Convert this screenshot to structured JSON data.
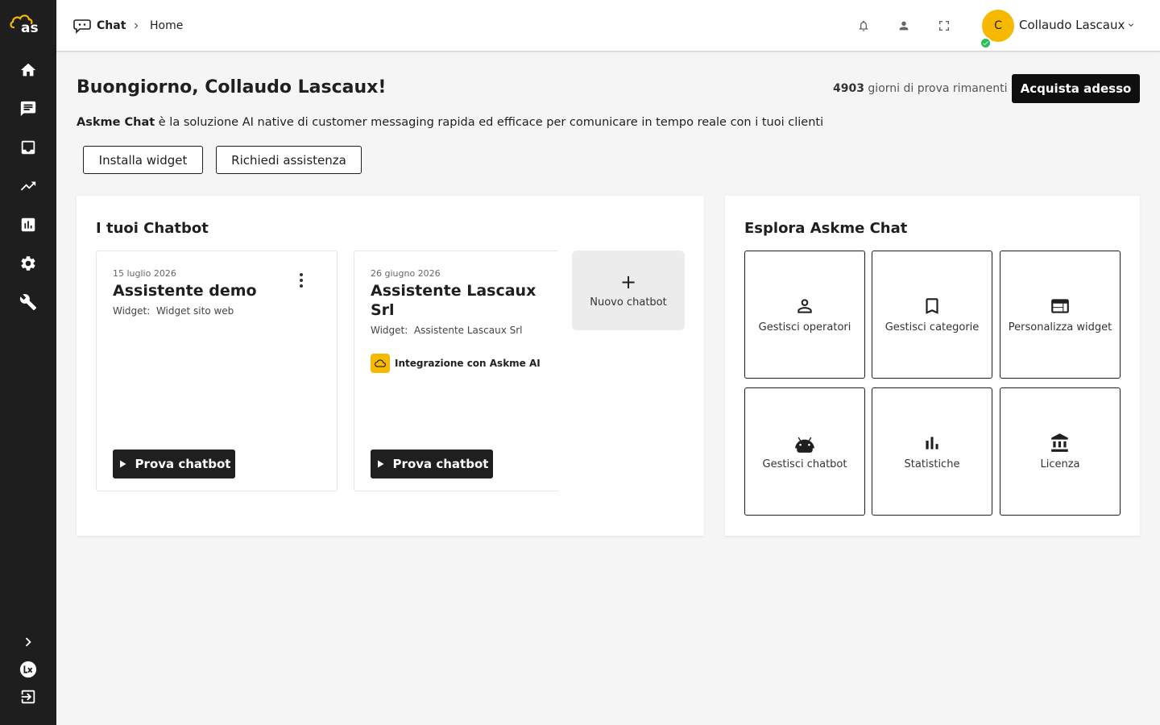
{
  "sidebar": {
    "logo_text": "as",
    "items": [
      {
        "icon": "home-icon"
      },
      {
        "icon": "chat-icon"
      },
      {
        "icon": "inbox-icon"
      },
      {
        "icon": "trending-up-icon"
      },
      {
        "icon": "bar-chart-icon"
      },
      {
        "icon": "gear-icon"
      },
      {
        "icon": "wrench-icon"
      }
    ],
    "bottom": [
      {
        "icon": "chevron-right-icon"
      },
      {
        "icon": "lx-logo-icon"
      },
      {
        "icon": "logout-icon"
      }
    ]
  },
  "topbar": {
    "breadcrumb": {
      "app": "Chat",
      "page": "Home"
    },
    "user": {
      "initial": "C",
      "name": "Collaudo Lascaux"
    }
  },
  "header": {
    "greeting": "Buongiorno, Collaudo Lascaux!",
    "trial_days": "4903",
    "trial_text": "giorni di prova rimanenti",
    "buy_label": "Acquista adesso",
    "intro_brand": "Askme Chat",
    "intro_text": "è la soluzione AI native di customer messaging rapida ed efficace per comunicare in tempo reale con i tuoi clienti",
    "install_label": "Installa widget",
    "support_label": "Richiedi assistenza"
  },
  "chatbots": {
    "title": "I tuoi Chatbot",
    "cards": [
      {
        "date": "15 luglio 2026",
        "title": "Assistente demo",
        "widget_prefix": "Widget:",
        "widget": "Widget sito web",
        "play_label": "Prova chatbot"
      },
      {
        "date": "26 giugno 2026",
        "title_line1": "Assistente Lascaux",
        "title_line2": "Srl",
        "widget_prefix": "Widget:",
        "widget": "Assistente Lascaux Srl",
        "integration": "Integrazione con Askme AI",
        "play_label": "Prova chatbot"
      }
    ],
    "new_label": "Nuovo chatbot",
    "new_symbol": "+"
  },
  "explore": {
    "title": "Esplora Askme Chat",
    "tiles": [
      {
        "label": "Gestisci operatori",
        "icon": "person-icon"
      },
      {
        "label": "Gestisci categorie",
        "icon": "bookmark-icon"
      },
      {
        "label": "Personalizza widget",
        "icon": "web-layout-icon"
      },
      {
        "label": "Gestisci chatbot",
        "icon": "android-icon"
      },
      {
        "label": "Statistiche",
        "icon": "bar-chart-icon"
      },
      {
        "label": "Licenza",
        "icon": "bank-icon"
      }
    ]
  }
}
